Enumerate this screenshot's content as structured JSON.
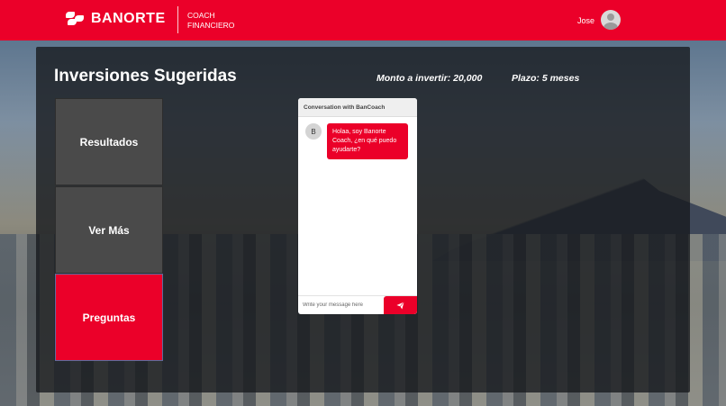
{
  "header": {
    "brand": "BANORTE",
    "product_line1": "COACH",
    "product_line2": "FINANCIERO",
    "user_name": "Jose"
  },
  "main": {
    "title": "Inversiones Sugeridas",
    "monto": "Monto a invertir: 20,000",
    "plazo": "Plazo: 5 meses"
  },
  "menu": {
    "resultados": "Resultados",
    "ver_mas": "Ver Más",
    "preguntas": "Preguntas"
  },
  "chat": {
    "header": "Conversation with BanCoach",
    "bot_initial": "B",
    "bot_message": "Holaa, soy Banorte Coach, ¿en qué puedo ayudarte?",
    "input_placeholder": "Write your message here"
  },
  "colors": {
    "brand_red": "#eb0029",
    "panel_bg": "#16181c",
    "menu_gray": "#4a4a4a"
  }
}
